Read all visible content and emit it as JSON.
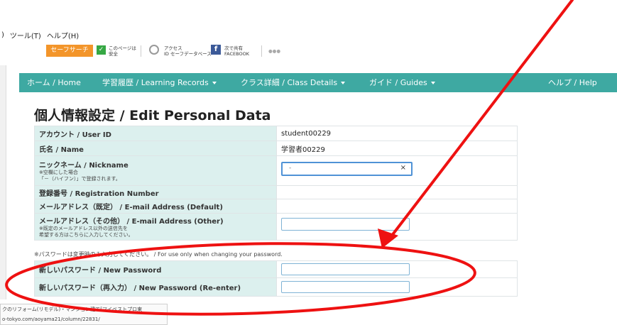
{
  "browser": {
    "menu": {
      "fragment": ")",
      "tools": "ツール(T)",
      "help": "ヘルプ(H)"
    },
    "toolbar": {
      "safe_search_label": "セーフサーチ",
      "page_safe_line1": "このページは",
      "page_safe_line2": "安全",
      "access_line1": "アクセス",
      "access_line2": "ID セーフデータベース",
      "facebook_line1": "次で共有",
      "facebook_line2": "FACEBOOK",
      "more": "●●●"
    }
  },
  "nav": {
    "items": [
      {
        "label": "ホーム / Home",
        "caret": false
      },
      {
        "label": "学習履歴 / Learning Records",
        "caret": true
      },
      {
        "label": "クラス詳細 / Class Details",
        "caret": true
      },
      {
        "label": "ガイド / Guides",
        "caret": true
      }
    ],
    "help": "ヘルプ / Help"
  },
  "page": {
    "title": "個人情報設定 / Edit Personal Data"
  },
  "profile_table": {
    "rows": [
      {
        "label": "アカウント / User ID",
        "value": "student00229"
      },
      {
        "label": "氏名 / Name",
        "value": "学習者00229"
      },
      {
        "label": "ニックネーム / Nickname",
        "note1": "※空欄にした場合",
        "note2": "「－（ハイフン）」で登録されます。",
        "input_value": "-",
        "clear": "×"
      },
      {
        "label": "登録番号 / Registration Number",
        "value": ""
      },
      {
        "label": "メールアドレス（既定） / E-mail Address (Default)",
        "value": ""
      },
      {
        "label": "メールアドレス（その他） / E-mail Address (Other)",
        "note1": "※既定のメールアドレス以外の送信先を",
        "note2": "希望する方はこちらに入力してください。",
        "input_value": ""
      }
    ]
  },
  "password_note": "※パスワードは変更時のみ入力してください。 / For use only when changing your password.",
  "password_table": {
    "rows": [
      {
        "label": "新しいパスワード / New Password"
      },
      {
        "label": "新しいパスワード（再入力） / New Password (Re-enter)"
      }
    ]
  },
  "hover_popup": {
    "line1": "クのリフォーム(リモデル)・マンション建て[マイベストプロ東",
    "line2": "o-tokyo.com/aoyama21/column/22831/"
  },
  "annotation": {
    "color": "#ee1111"
  }
}
